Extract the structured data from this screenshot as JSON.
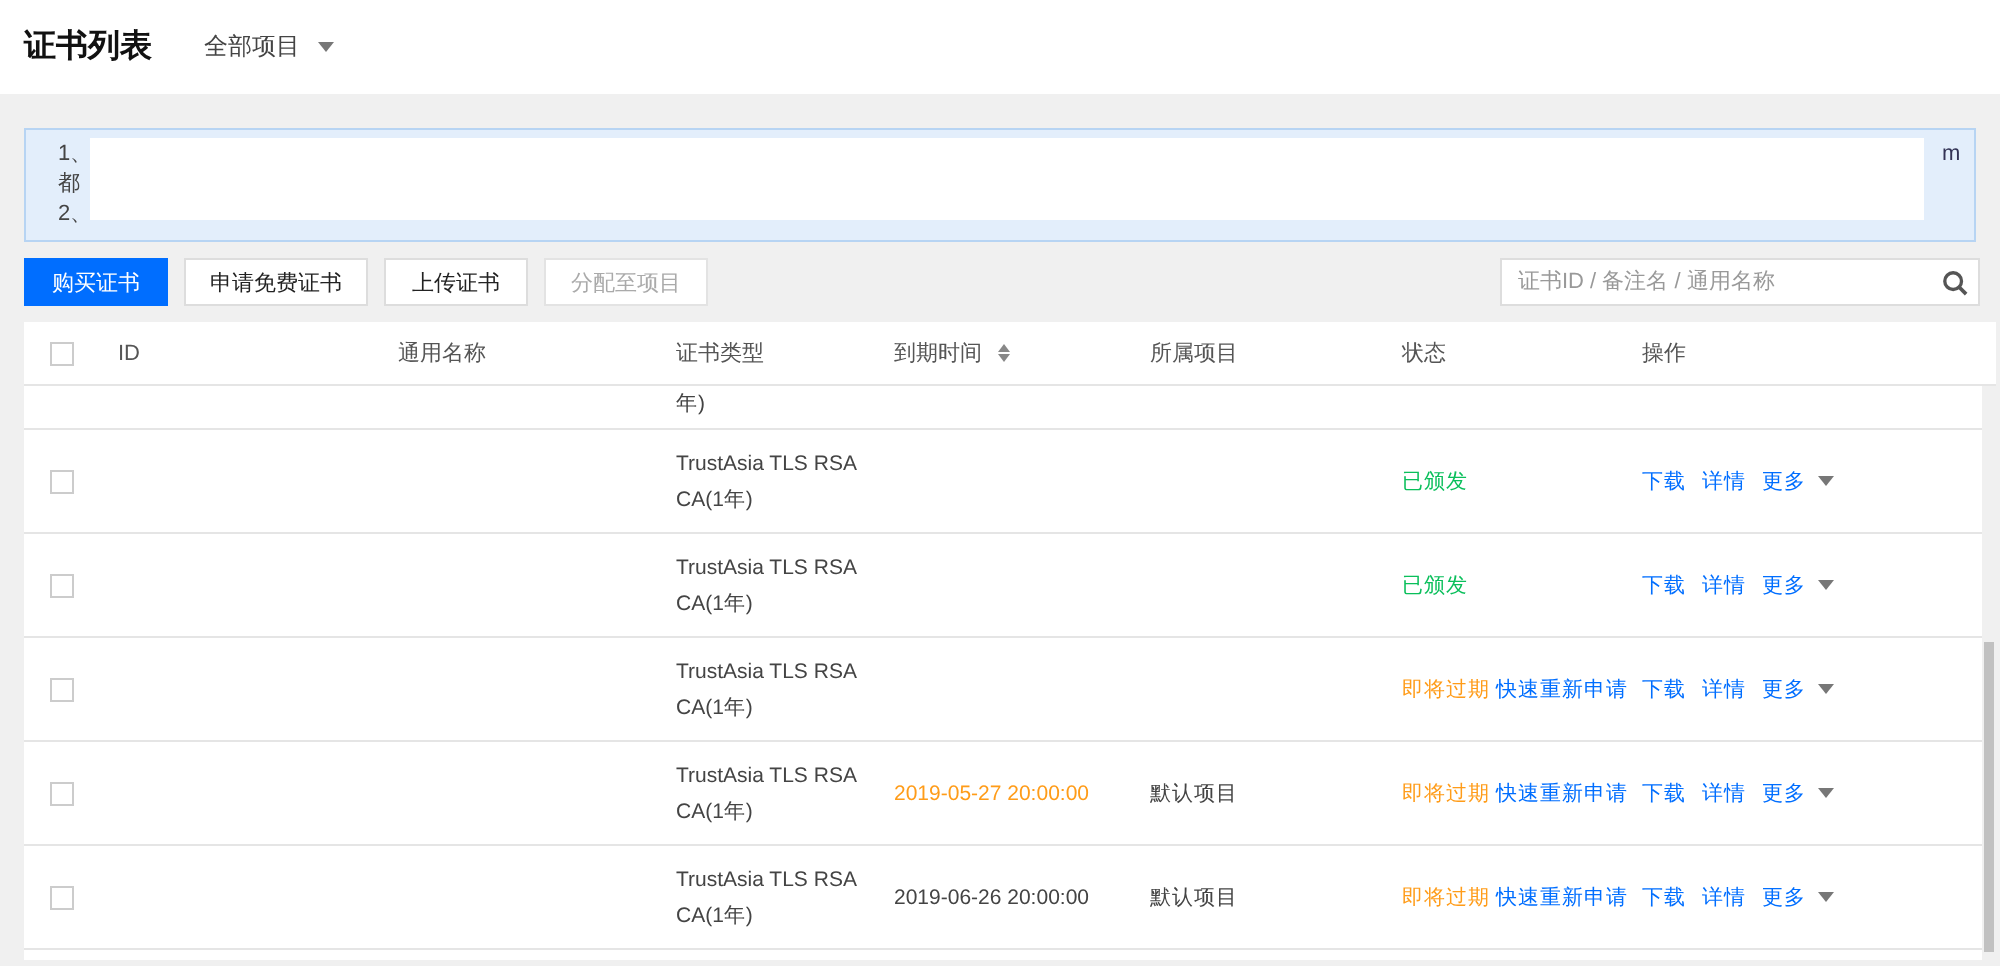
{
  "header": {
    "title": "证书列表",
    "project_filter": "全部项目"
  },
  "notice": {
    "lines": [
      "1、",
      "都",
      "2、"
    ],
    "trailing": "m"
  },
  "toolbar": {
    "buttons": [
      {
        "label": "购买证书",
        "kind": "primary"
      },
      {
        "label": "申请免费证书",
        "kind": "default"
      },
      {
        "label": "上传证书",
        "kind": "default"
      },
      {
        "label": "分配至项目",
        "kind": "disabled"
      }
    ],
    "search": {
      "placeholder": "证书ID / 备注名 / 通用名称"
    }
  },
  "table": {
    "columns": [
      "ID",
      "通用名称",
      "证书类型",
      "到期时间",
      "所属项目",
      "状态",
      "操作"
    ],
    "header_checked": false,
    "rows": [
      {
        "cert_type": "年)"
      },
      {
        "checked": false,
        "cert_type": "TrustAsia TLS RSA CA(1年)",
        "status": {
          "kind": "issued",
          "label": "已颁发"
        },
        "actions": [
          "下载",
          "详情",
          "更多"
        ]
      },
      {
        "checked": false,
        "cert_type": "TrustAsia TLS RSA CA(1年)",
        "status": {
          "kind": "issued",
          "label": "已颁发"
        },
        "actions": [
          "下载",
          "详情",
          "更多"
        ]
      },
      {
        "checked": false,
        "cert_type": "TrustAsia TLS RSA CA(1年)",
        "status": {
          "kind": "expiring",
          "label": "即将过期",
          "link": "快速重新申请"
        },
        "actions": [
          "下载",
          "详情",
          "更多"
        ]
      },
      {
        "checked": false,
        "cert_type": "TrustAsia TLS RSA CA(1年)",
        "expiry": "2019-05-27 20:00:00",
        "expiry_warning": true,
        "project": "默认项目",
        "status": {
          "kind": "expiring",
          "label": "即将过期",
          "link": "快速重新申请"
        },
        "actions": [
          "下载",
          "详情",
          "更多"
        ]
      },
      {
        "checked": false,
        "cert_type": "TrustAsia TLS RSA CA(1年)",
        "expiry": "2019-06-26 20:00:00",
        "expiry_warning": false,
        "project": "默认项目",
        "status": {
          "kind": "expiring",
          "label": "即将过期",
          "link": "快速重新申请"
        },
        "actions": [
          "下载",
          "详情",
          "更多"
        ]
      }
    ]
  }
}
